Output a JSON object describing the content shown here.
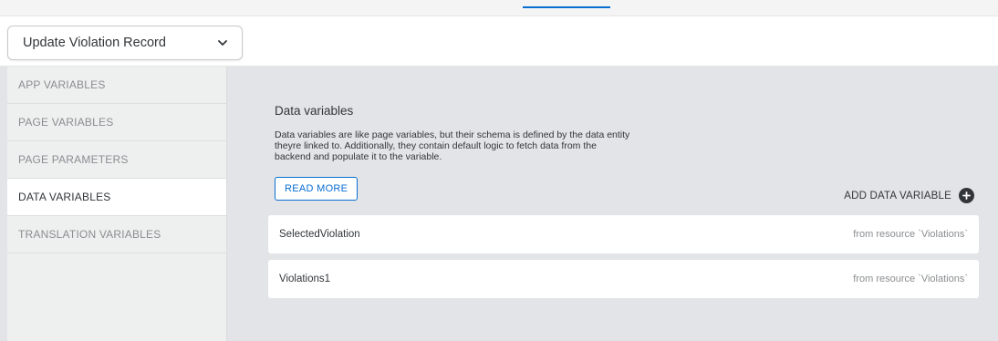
{
  "header": {
    "page_selector": "Update Violation Record"
  },
  "sidebar": {
    "items": [
      {
        "label": "APP VARIABLES",
        "active": false
      },
      {
        "label": "PAGE VARIABLES",
        "active": false
      },
      {
        "label": "PAGE PARAMETERS",
        "active": false
      },
      {
        "label": "DATA VARIABLES",
        "active": true
      },
      {
        "label": "TRANSLATION VARIABLES",
        "active": false
      }
    ]
  },
  "main": {
    "title": "Data variables",
    "description_lines": [
      "Data variables are like page variables, but their schema is defined by the data entity",
      "theyre linked to. Additionally, they contain default logic to fetch data from the",
      "backend and populate it to the variable."
    ],
    "read_more": "READ MORE",
    "add_data_variable": "ADD DATA VARIABLE",
    "variables": [
      {
        "name": "SelectedViolation",
        "source": "from resource `Violations`"
      },
      {
        "name": "Violations1",
        "source": "from resource `Violations`"
      }
    ]
  },
  "icons": {
    "page_selector": "chevron-down-icon",
    "add_data_variable": "plus-circle-icon"
  },
  "colors": {
    "accent": "#0a6ed1",
    "content_background": "#e3e4e7",
    "sidebar_background": "#eef0f0"
  }
}
